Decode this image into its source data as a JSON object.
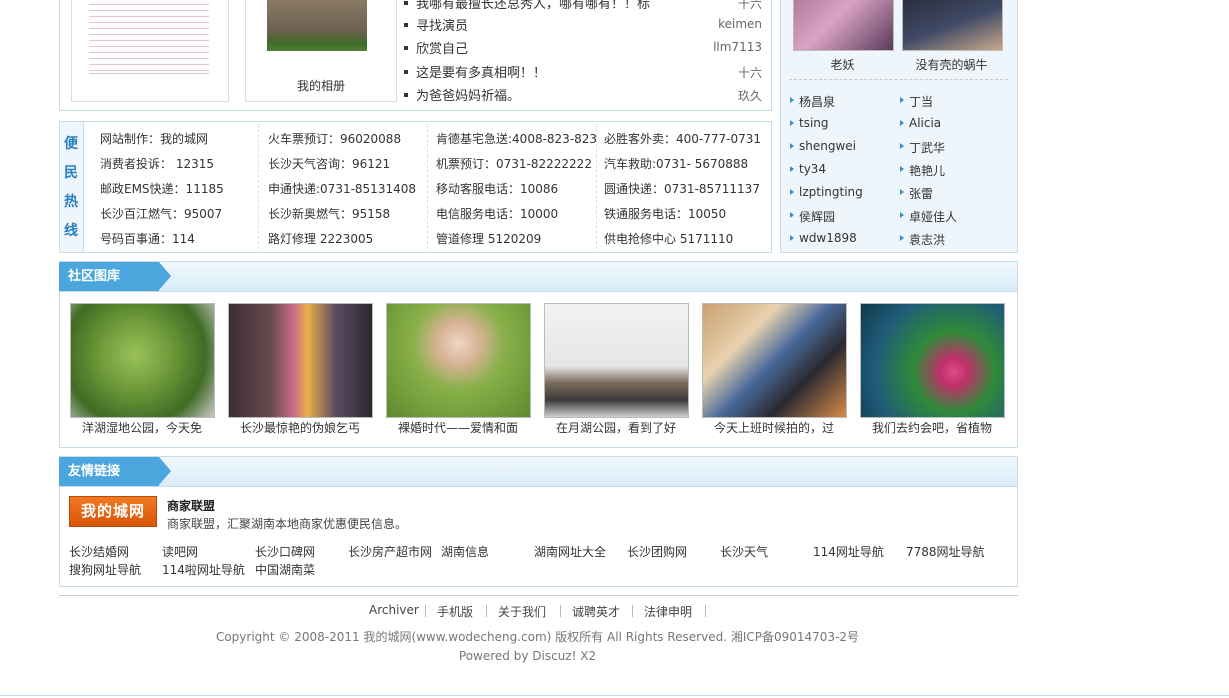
{
  "album": {
    "label": "我的相册"
  },
  "news": [
    {
      "title": "我哪有最擅长还总秀人，哪有哪有！！标",
      "author": "十六"
    },
    {
      "title": "寻找演员",
      "author": "keimen"
    },
    {
      "title": "欣赏自己",
      "author": "llm7113"
    },
    {
      "title": "这是要有多真相啊！！",
      "author": "十六"
    },
    {
      "title": "为爸爸妈妈祈福。",
      "author": "玖久"
    }
  ],
  "top_avatars": [
    {
      "name": "老妖"
    },
    {
      "name": "没有壳的蜗牛"
    }
  ],
  "hotline": {
    "label_chars": [
      "便",
      "民",
      "热",
      "线"
    ],
    "rows": [
      [
        "网站制作：我的城网",
        "火车票预订：96020088",
        "肯德基宅急送:4008-823-823",
        "必胜客外卖：400-777-0731"
      ],
      [
        "消费者投诉： 12315",
        "长沙天气咨询：96121",
        "机票预订：0731-82222222",
        "汽车救助:0731- 5670888"
      ],
      [
        "邮政EMS快递：11185",
        "申通快递:0731-85131408",
        "移动客服电话：10086",
        "圆通快递：0731-85711137"
      ],
      [
        "长沙百江燃气：95007",
        "长沙新奥燃气：95158",
        "电信服务电话：10000",
        "铁通服务电话：10050"
      ],
      [
        "号码百事通：114",
        "路灯修理 2223005",
        "管道修理 5120209",
        "供电抢修中心 5171110"
      ]
    ]
  },
  "users": [
    [
      "杨昌泉",
      "丁当"
    ],
    [
      "tsing",
      "Alicia"
    ],
    [
      "shengwei",
      "丁武华"
    ],
    [
      "ty34",
      "艳艳儿"
    ],
    [
      "lzptingting",
      "张雷"
    ],
    [
      "侯辉园",
      "卓娅佳人"
    ],
    [
      "wdw1898",
      "袁志洪"
    ]
  ],
  "gallery": {
    "title": "社区图库",
    "items": [
      {
        "caption": "洋湖湿地公园，今天免"
      },
      {
        "caption": "长沙最惊艳的伪娘乞丐"
      },
      {
        "caption": "裸婚时代——爱情和面"
      },
      {
        "caption": "在月湖公园，看到了好"
      },
      {
        "caption": "今天上班时候拍的，过"
      },
      {
        "caption": "我们去约会吧，省植物"
      }
    ]
  },
  "friends": {
    "title": "友情链接",
    "logo_text": "我的城网",
    "partner_title": "商家联盟",
    "partner_desc": "商家联盟，汇聚湖南本地商家优惠便民信息。",
    "links_row1": [
      "长沙结婚网",
      "读吧网",
      "长沙口碑网",
      "长沙房产超市网",
      "湖南信息",
      "湖南网址大全",
      "长沙团购网",
      "长沙天气",
      "114网址导航",
      "7788网址导航"
    ],
    "links_row2": [
      "搜狗网址导航",
      "114啦网址导航",
      "中国湖南菜"
    ]
  },
  "footer": {
    "nav": [
      "Archiver",
      "手机版",
      "关于我们",
      "诚聘英才",
      "法律申明"
    ],
    "copyright": "Copyright © 2008-2011 我的城网(www.wodecheng.com) 版权所有 All Rights Reserved. 湘ICP备09014703-2号",
    "powered": "Powered by Discuz! X2"
  },
  "colors": {
    "accent": "#4aa6dd",
    "border": "#c9dde9",
    "user_bg": "#eef6fc"
  }
}
